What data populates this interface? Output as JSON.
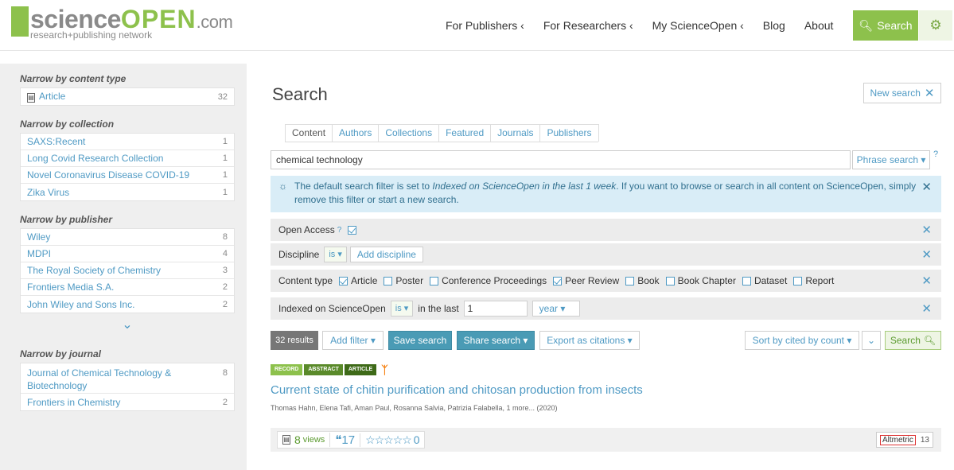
{
  "header": {
    "logo_science": "science",
    "logo_open": "OPEN",
    "logo_com": ".com",
    "logo_tagline": "research+publishing network",
    "nav": [
      "For Publishers ‹",
      "For Researchers ‹",
      "My ScienceOpen ‹",
      "Blog",
      "About"
    ],
    "search_label": "Search",
    "accent": "#8dc14c"
  },
  "sidebar": {
    "content_type_title": "Narrow by content type",
    "content_types": [
      {
        "label": "Article",
        "count": "32"
      }
    ],
    "collection_title": "Narrow by collection",
    "collections": [
      {
        "label": "SAXS:Recent",
        "count": "1"
      },
      {
        "label": "Long Covid Research Collection",
        "count": "1"
      },
      {
        "label": "Novel Coronavirus Disease COVID-19",
        "count": "1"
      },
      {
        "label": "Zika Virus",
        "count": "1"
      }
    ],
    "publisher_title": "Narrow by publisher",
    "publishers": [
      {
        "label": "Wiley",
        "count": "8"
      },
      {
        "label": "MDPI",
        "count": "4"
      },
      {
        "label": "The Royal Society of Chemistry",
        "count": "3"
      },
      {
        "label": "Frontiers Media S.A.",
        "count": "2"
      },
      {
        "label": "John Wiley and Sons Inc.",
        "count": "2"
      }
    ],
    "journal_title": "Narrow by journal",
    "journals": [
      {
        "label": "Journal of Chemical Technology & Biotechnology",
        "count": "8"
      },
      {
        "label": "Frontiers in Chemistry",
        "count": "2"
      }
    ]
  },
  "main": {
    "heading": "Search",
    "new_search": "New search",
    "tabs": [
      "Content",
      "Authors",
      "Collections",
      "Featured",
      "Journals",
      "Publishers"
    ],
    "query": "chemical technology",
    "phrase_search": "Phrase search ▾",
    "info_pre": "The default search filter is set to ",
    "info_em": "Indexed on ScienceOpen in the last 1 week",
    "info_post": ". If you want to browse or search in all content on ScienceOpen, simply remove this filter or start a new search.",
    "filters": {
      "open_access": "Open Access",
      "discipline": "Discipline",
      "is": "is ▾",
      "add_discipline": "Add discipline",
      "content_type": "Content type",
      "content_options": [
        {
          "label": "Article",
          "checked": true
        },
        {
          "label": "Poster",
          "checked": false
        },
        {
          "label": "Conference Proceedings",
          "checked": false
        },
        {
          "label": "Peer Review",
          "checked": true
        },
        {
          "label": "Book",
          "checked": false
        },
        {
          "label": "Book Chapter",
          "checked": false
        },
        {
          "label": "Dataset",
          "checked": false
        },
        {
          "label": "Report",
          "checked": false
        }
      ],
      "indexed": "Indexed on ScienceOpen",
      "in_the_last": "in the last",
      "number": "1",
      "unit": "year ▾"
    },
    "toolbar": {
      "results": "32 results",
      "add_filter": "Add filter ▾",
      "save_search": "Save search",
      "share_search": "Share search ▾",
      "export": "Export as citations ▾",
      "sort": "Sort by cited by count ▾",
      "search": "Search"
    },
    "result": {
      "badges": [
        "RECORD",
        "ABSTRACT",
        "ARTICLE"
      ],
      "title": "Current state of chitin purification and chitosan production from insects",
      "authors": "Thomas Hahn, Elena Tafi, Aman Paul, Rosanna Salvia, Patrizia Falabella, 1 more...  (2020)",
      "views": "8",
      "views_label": "views",
      "cites": "17",
      "rating": "0",
      "altmetric": "Altmetric",
      "altmetric_score": "13"
    }
  }
}
